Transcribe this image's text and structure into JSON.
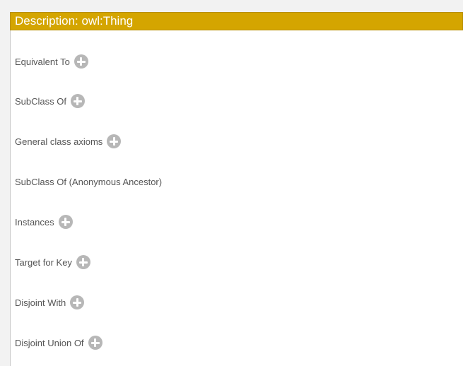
{
  "header": {
    "title": "Description: owl:Thing"
  },
  "sections": [
    {
      "label": "Equivalent To",
      "addable": true
    },
    {
      "label": "SubClass Of",
      "addable": true
    },
    {
      "label": "General class axioms",
      "addable": true
    },
    {
      "label": "SubClass Of (Anonymous Ancestor)",
      "addable": false
    },
    {
      "label": "Instances",
      "addable": true
    },
    {
      "label": "Target for Key",
      "addable": true
    },
    {
      "label": "Disjoint With",
      "addable": true
    },
    {
      "label": "Disjoint Union Of",
      "addable": true
    }
  ],
  "icons": {
    "add": "add-circle-icon"
  },
  "colors": {
    "header_bg": "#d4a500",
    "header_text": "#ffffff",
    "label_text": "#555555",
    "add_icon": "#b7b7b7"
  }
}
